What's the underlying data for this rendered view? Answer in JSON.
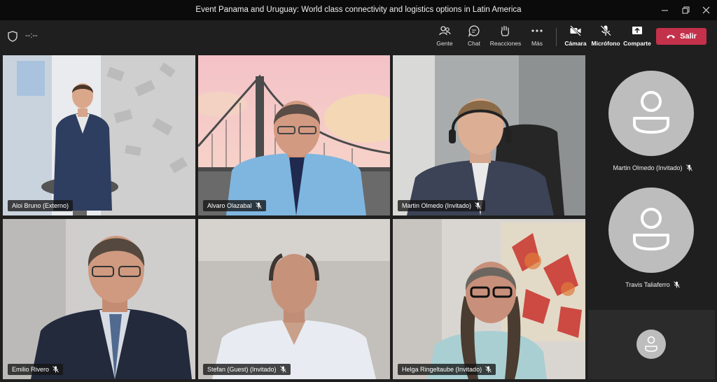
{
  "window": {
    "title": "Event Panama and Uruguay: World class connectivity and logistics options in Latin America"
  },
  "toolbar": {
    "timer": "--:--",
    "people_label": "Gente",
    "chat_label": "Chat",
    "reactions_label": "Reacciones",
    "more_label": "Más",
    "camera_label": "Cámara",
    "mic_label": "Micrófono",
    "share_label": "Comparte",
    "leave_label": "Salir"
  },
  "participants": [
    {
      "name": "Aloi Bruno (Externo)"
    },
    {
      "name": "Alvaro Olazabal"
    },
    {
      "name": "Martin Olmedo (Invitado)"
    },
    {
      "name": "Emilio Rivero"
    },
    {
      "name": "Stefan (Guest) (Invitado)"
    },
    {
      "name": "Helga Ringeltaube (Invitado)"
    }
  ],
  "sidebar": [
    {
      "name": "Martin Olmedo (Invitado)"
    },
    {
      "name": "Travis Taliaferro"
    }
  ],
  "colors": {
    "accent": "#8b8fe3",
    "leave": "#c4314b"
  }
}
